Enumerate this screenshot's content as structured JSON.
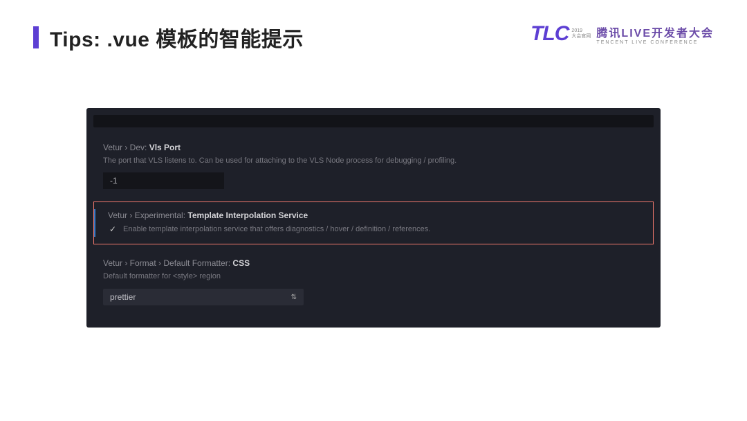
{
  "header": {
    "title": "Tips: .vue 模板的智能提示"
  },
  "logo": {
    "tlc": "TLC",
    "year1": "2019",
    "year2": "大会官网",
    "cn": "腾讯LIVE开发者大会",
    "en": "TENCENT LIVE CONFERENCE"
  },
  "settings": {
    "vlsPort": {
      "path": "Vetur › Dev:",
      "name": "Vls Port",
      "desc": "The port that VLS listens to. Can be used for attaching to the VLS Node process for debugging / profiling.",
      "value": "-1"
    },
    "experimental": {
      "path": "Vetur › Experimental:",
      "name": "Template Interpolation Service",
      "checkbox_label": "Enable template interpolation service that offers diagnostics / hover / definition / references."
    },
    "formatter": {
      "path": "Vetur › Format › Default Formatter:",
      "name": "CSS",
      "desc": "Default formatter for <style> region",
      "select_value": "prettier"
    }
  }
}
